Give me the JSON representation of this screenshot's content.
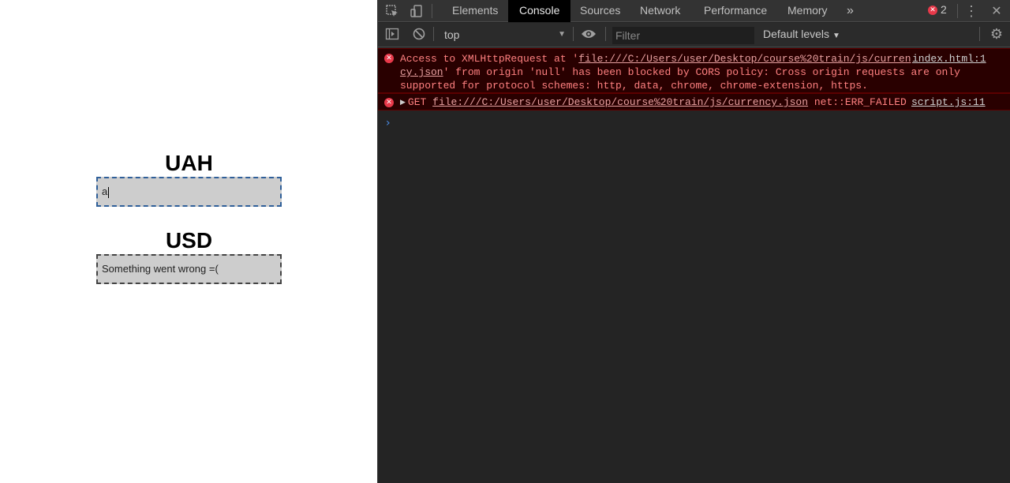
{
  "page": {
    "uah": {
      "label": "UAH",
      "value": "a"
    },
    "usd": {
      "label": "USD",
      "value": "Something went wrong =("
    }
  },
  "devtools": {
    "tabs": [
      "Elements",
      "Console",
      "Sources",
      "Network",
      "Performance",
      "Memory"
    ],
    "active_tab": "Console",
    "more_tabs": "»",
    "error_count": "2",
    "context": "top",
    "filter_placeholder": "Filter",
    "levels_label": "Default levels",
    "messages": [
      {
        "line1_prefix": "Access to XMLHttpRequest at '",
        "line1_link": "file:///C:/Users/user/Desktop/course%20train/js/curren",
        "line2_link": "cy.json",
        "line2_rest": "' from origin 'null' has been blocked by CORS policy: Cross origin requests are only",
        "line3": "supported for protocol schemes: http, data, chrome, chrome-extension, https.",
        "source": "index.html:1"
      },
      {
        "method": "GET",
        "url": "file:///C:/Users/user/Desktop/course%20train/js/currency.json",
        "status": "net::ERR_FAILED",
        "source": "script.js:11"
      }
    ],
    "prompt": "›"
  },
  "colors": {
    "error_bg": "#290000",
    "error_text": "#ff8080",
    "devtools_bg": "#242424",
    "input_bg": "#cdcdcd"
  },
  "icons": [
    "inspect-icon",
    "device-toggle-icon",
    "close-icon",
    "kebab-menu-icon",
    "error-count-icon",
    "sidebar-toggle-icon",
    "clear-console-icon",
    "eye-icon",
    "settings-gear-icon"
  ]
}
